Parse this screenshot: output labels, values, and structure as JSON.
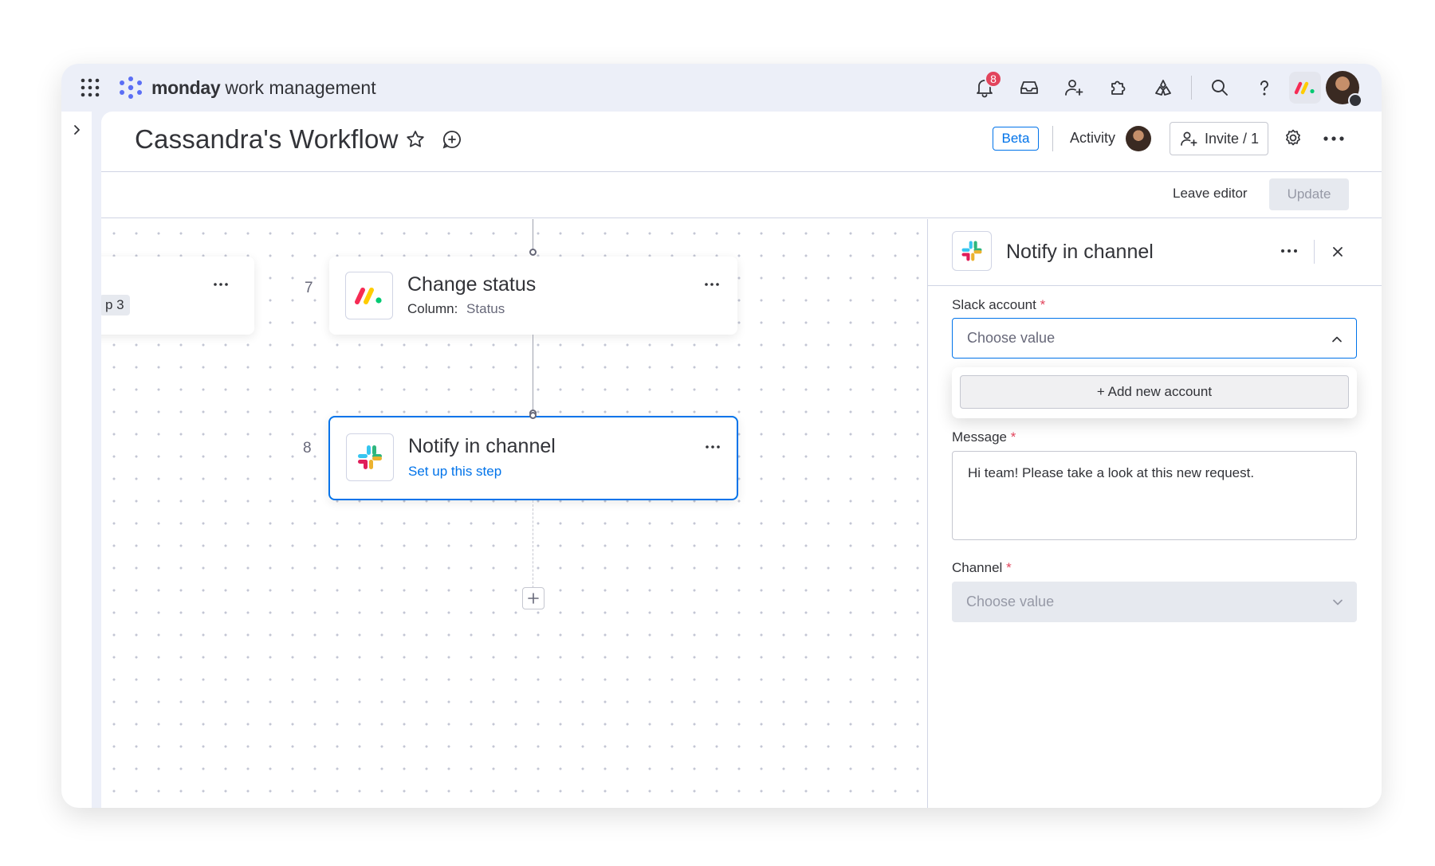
{
  "app": {
    "brand": "monday",
    "product": "work management"
  },
  "notifications": {
    "count": "8"
  },
  "board": {
    "title": "Cassandra's Workflow",
    "beta_label": "Beta",
    "activity_label": "Activity",
    "invite_label": "Invite / 1"
  },
  "editor": {
    "leave_label": "Leave editor",
    "update_label": "Update"
  },
  "canvas": {
    "partial_node": {
      "tag": "p 3"
    },
    "nodes": [
      {
        "step": "7",
        "title": "Change status",
        "sub_key": "Column:",
        "sub_value": "Status"
      },
      {
        "step": "8",
        "title": "Notify in channel",
        "link": "Set up this step"
      }
    ]
  },
  "panel": {
    "title": "Notify in channel",
    "slack_label": "Slack account",
    "slack_placeholder": "Choose value",
    "add_account_label": "+ Add new account",
    "message_label": "Message",
    "message_value": "Hi team! Please take a look at this new request.",
    "channel_label": "Channel",
    "channel_placeholder": "Choose value",
    "required_mark": "*"
  },
  "colors": {
    "accent": "#0073ea",
    "required": "#e2445c",
    "badge": "#e2445c"
  }
}
